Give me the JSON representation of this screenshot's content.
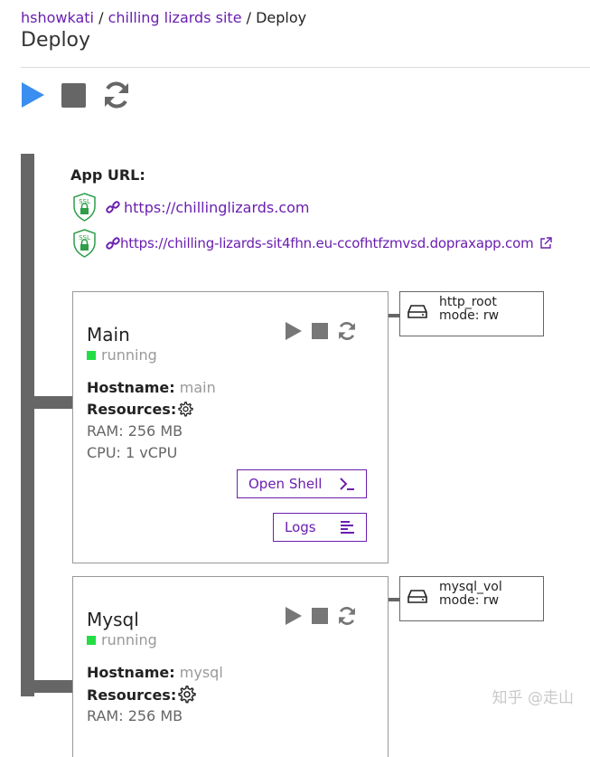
{
  "breadcrumb": {
    "user": "hshowkati",
    "sep1": " / ",
    "site": "chilling lizards site",
    "sep2": " / ",
    "current": "Deploy"
  },
  "page_title": "Deploy",
  "toolbar": {
    "play_icon": "play-icon",
    "stop_icon": "stop-icon",
    "refresh_icon": "refresh-icon",
    "colors": {
      "play": "#3a8ef0",
      "stop": "#666666",
      "refresh": "#666666"
    }
  },
  "app_url": {
    "label": "App URL:",
    "urls": [
      {
        "text": "https://chillinglizards.com",
        "ssl": "SSL"
      },
      {
        "text": "https://chilling-lizards-sit4fhn.eu-ccofhtfzmvsd.dopraxapp.com",
        "ssl": "SSL"
      }
    ]
  },
  "services": [
    {
      "name": "Main",
      "status": "running",
      "hostname_label": "Hostname:",
      "hostname": "main",
      "resources_label": "Resources:",
      "ram": "RAM: 256 MB",
      "cpu": "CPU: 1 vCPU",
      "open_shell": "Open Shell",
      "logs": "Logs",
      "volume": {
        "name": "http_root",
        "mode": "mode: rw"
      }
    },
    {
      "name": "Mysql",
      "status": "running",
      "hostname_label": "Hostname:",
      "hostname": "mysql",
      "resources_label": "Resources:",
      "ram": "RAM: 256 MB",
      "volume": {
        "name": "mysql_vol",
        "mode": "mode: rw"
      }
    }
  ],
  "watermark": "知乎 @走山",
  "colors": {
    "accent": "#6a1fb0",
    "running": "#22dd44",
    "ssl_green": "#2e9e4a"
  }
}
